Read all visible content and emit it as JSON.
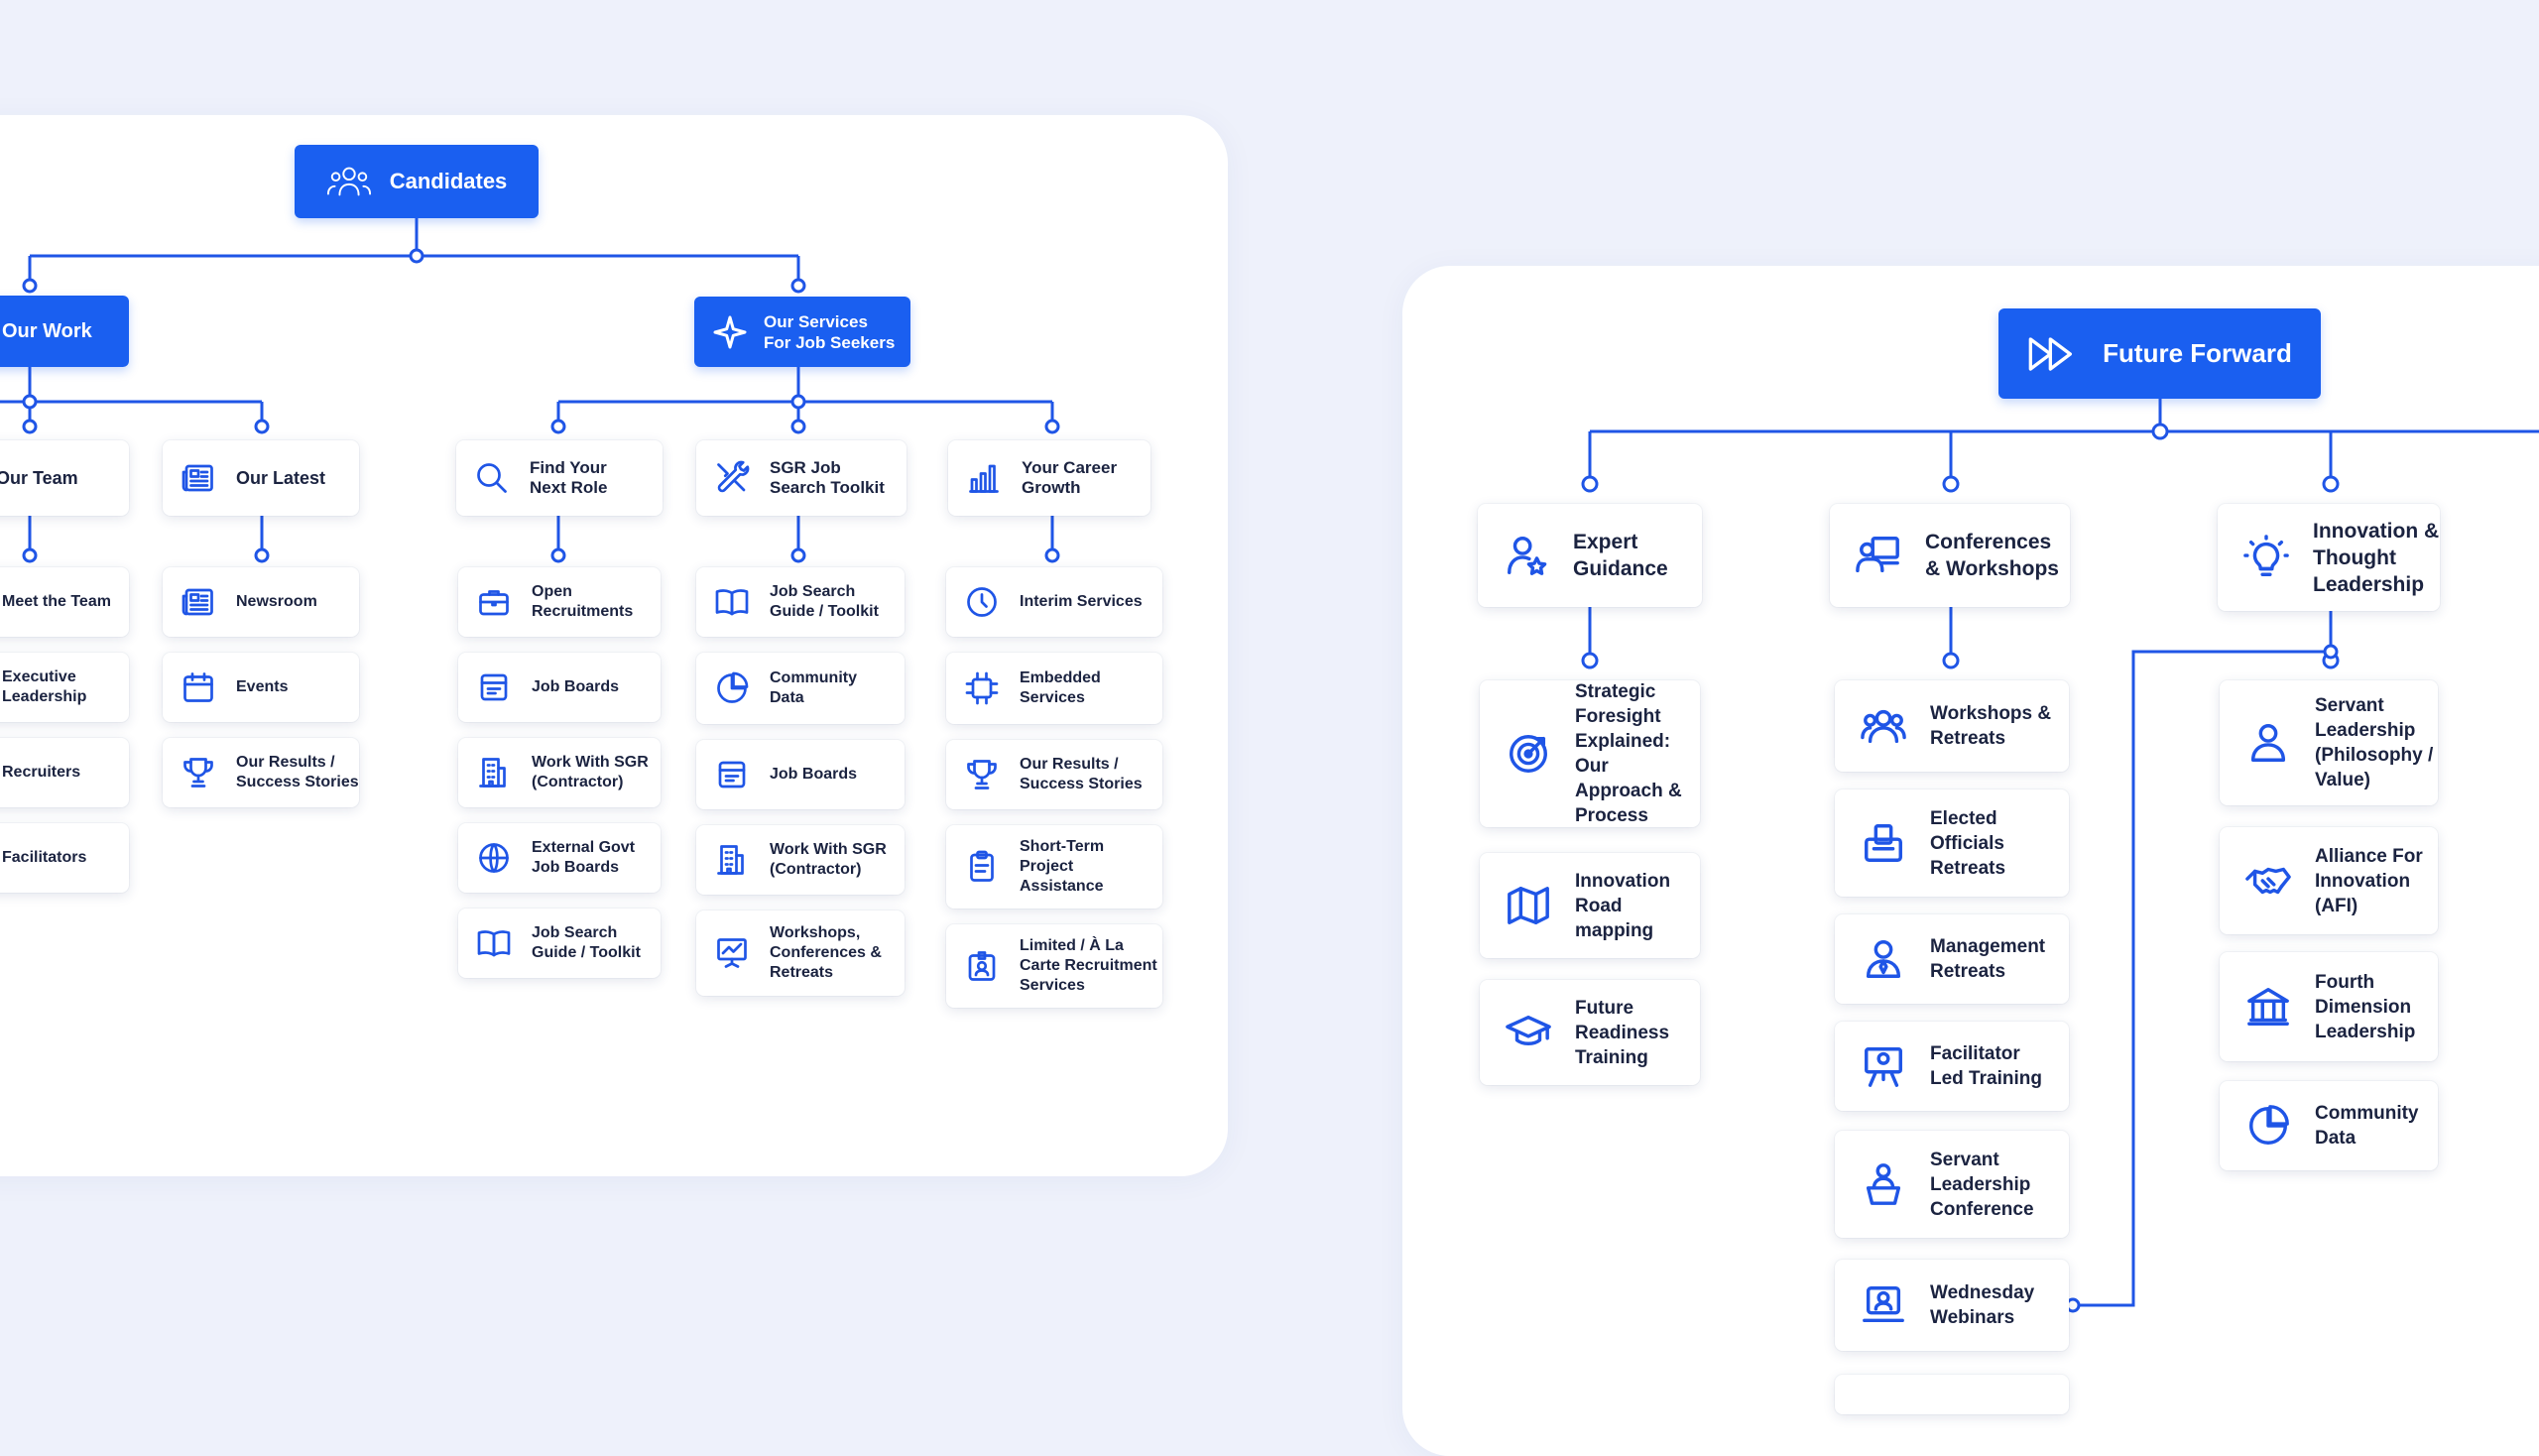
{
  "candidates_panel": {
    "root": {
      "label": "Candidates",
      "icon": "users-icon"
    },
    "our_work": {
      "label": "Our Work",
      "our_team": {
        "label": "Our Team",
        "children": [
          "Meet the Team",
          "Executive\nLeadership",
          "Recruiters",
          "Facilitators"
        ]
      },
      "our_latest": {
        "label": "Our Latest",
        "icon": "newspaper-icon",
        "children": [
          {
            "label": "Newsroom",
            "icon": "newspaper-icon"
          },
          {
            "label": "Events",
            "icon": "calendar-icon"
          },
          {
            "label": "Our Results /\nSuccess Stories",
            "icon": "trophy-icon"
          }
        ]
      }
    },
    "our_services": {
      "label": "Our Services\nFor Job Seekers",
      "icon": "sparkle-icon",
      "find_role": {
        "label": "Find Your\nNext Role",
        "icon": "search-icon",
        "children": [
          {
            "label": "Open\nRecruitments",
            "icon": "briefcase-icon"
          },
          {
            "label": "Job Boards",
            "icon": "board-icon"
          },
          {
            "label": "Work With SGR\n(Contractor)",
            "icon": "building-icon"
          },
          {
            "label": "External Govt\nJob Boards",
            "icon": "globe-icon"
          },
          {
            "label": "Job Search\nGuide / Toolkit",
            "icon": "book-icon"
          }
        ]
      },
      "toolkit": {
        "label": "SGR Job\nSearch Toolkit",
        "icon": "tools-icon",
        "children": [
          {
            "label": "Job Search\nGuide / Toolkit",
            "icon": "book-icon"
          },
          {
            "label": "Community\nData",
            "icon": "pie-chart-icon"
          },
          {
            "label": "Job Boards",
            "icon": "board-icon"
          },
          {
            "label": "Work With SGR\n(Contractor)",
            "icon": "building-icon"
          },
          {
            "label": "Workshops,\nConferences &\nRetreats",
            "icon": "presentation-icon"
          }
        ]
      },
      "career": {
        "label": "Your Career\nGrowth",
        "icon": "bar-chart-icon",
        "children": [
          {
            "label": "Interim Services",
            "icon": "clock-icon"
          },
          {
            "label": "Embedded\nServices",
            "icon": "chip-icon"
          },
          {
            "label": "Our Results /\nSuccess Stories",
            "icon": "trophy-icon"
          },
          {
            "label": "Short-Term\nProject\nAssistance",
            "icon": "clipboard-icon"
          },
          {
            "label": "Limited / À La\nCarte Recruitment\nServices",
            "icon": "badge-icon"
          }
        ]
      }
    }
  },
  "future_panel": {
    "root": {
      "label": "Future Forward",
      "icon": "fast-forward-icon"
    },
    "expert": {
      "label": "Expert\nGuidance",
      "icon": "user-star-icon",
      "children": [
        {
          "label": "Strategic\nForesight\nExplained:\nOur Approach &\nProcess",
          "icon": "target-icon"
        },
        {
          "label": "Innovation\nRoad\nmapping",
          "icon": "map-icon"
        },
        {
          "label": "Future\nReadiness\nTraining",
          "icon": "graduation-cap-icon"
        }
      ]
    },
    "conferences": {
      "label": "Conferences\n& Workshops",
      "icon": "people-board-icon",
      "children": [
        {
          "label": "Workshops &\nRetreats",
          "icon": "group-icon"
        },
        {
          "label": "Elected\nOfficials\nRetreats",
          "icon": "ballot-box-icon"
        },
        {
          "label": "Management\nRetreats",
          "icon": "manager-icon"
        },
        {
          "label": "Facilitator\nLed Training",
          "icon": "easel-icon"
        },
        {
          "label": "Servant\nLeadership\nConference",
          "icon": "podium-icon"
        },
        {
          "label": "Wednesday\nWebinars",
          "icon": "webinar-icon"
        }
      ]
    },
    "innovation": {
      "label": "Innovation &\nThought\nLeadership",
      "icon": "lightbulb-icon",
      "children": [
        {
          "label": "Servant\nLeadership\n(Philosophy /\nValue)",
          "icon": "person-icon"
        },
        {
          "label": "Alliance For\nInnovation\n(AFI)",
          "icon": "handshake-icon"
        },
        {
          "label": "Fourth\nDimension\nLeadership",
          "icon": "institution-icon"
        },
        {
          "label": "Community\nData",
          "icon": "pie-chart-icon"
        }
      ]
    }
  }
}
